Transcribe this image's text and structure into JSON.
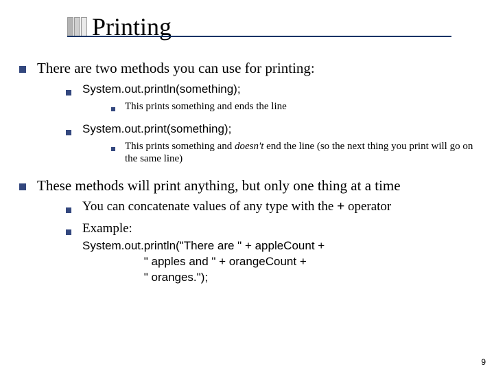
{
  "title": "Printing",
  "bullets": {
    "b1": "There are two methods you can use for printing:",
    "b1a": "System.out.println(something);",
    "b1a_i": "This prints something and ends the line",
    "b1b": "System.out.print(something);",
    "b1b_i_pre": "This prints something and ",
    "b1b_i_em": "doesn't",
    "b1b_i_post": " end the line (so the next thing you print will go on the same line)",
    "b2": "These methods will print anything, but only one thing at a time",
    "b2a_pre": "You can concatenate values of any type with the ",
    "b2a_op": "+",
    "b2a_post": " operator",
    "b2b_label": "Example:",
    "example_l1": "System.out.println(\"There are \" + appleCount +",
    "example_l2": "                   \" apples and \" + orangeCount +",
    "example_l3": "                   \" oranges.\");"
  },
  "page_number": "9"
}
